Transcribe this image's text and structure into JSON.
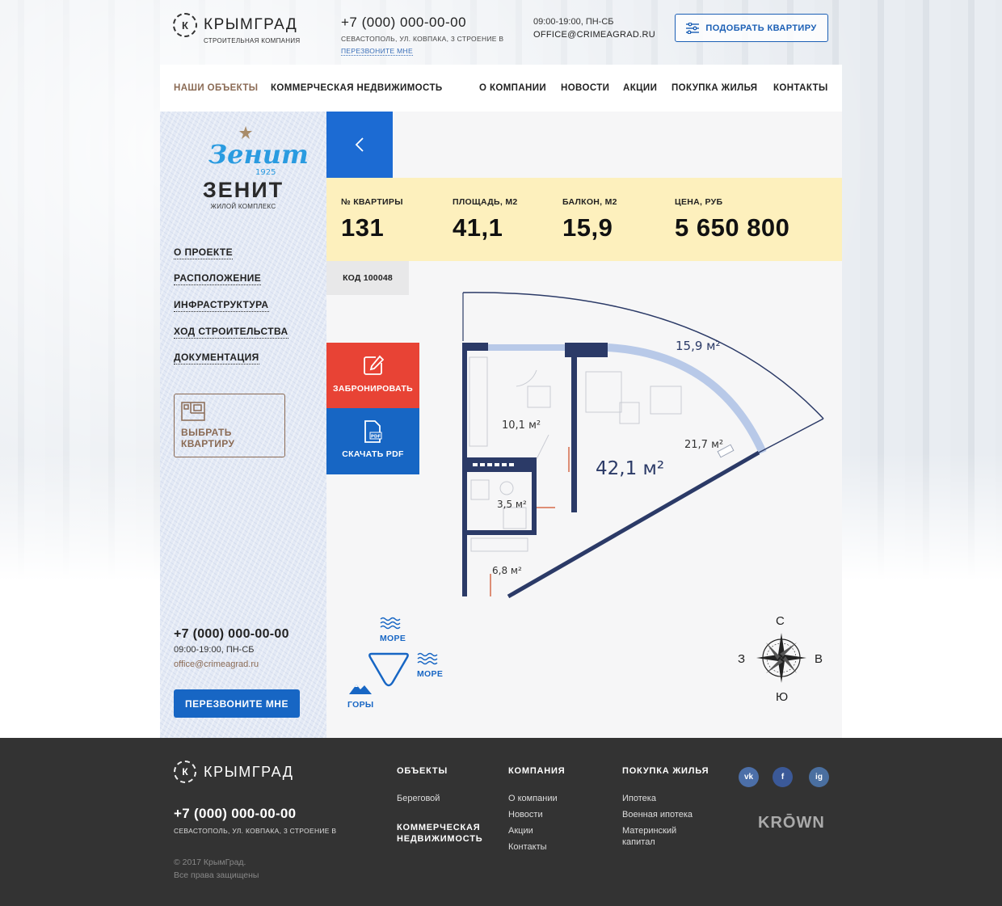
{
  "brand": {
    "name": "КРЫМГРАД",
    "subtitle": "СТРОИТЕЛЬНАЯ КОМПАНИЯ",
    "mark": "К"
  },
  "header": {
    "phone": "+7 (000) 000-00-00",
    "address": "СЕВАСТОПОЛЬ, УЛ. КОВПАКА, 3 СТРОЕНИЕ В",
    "callback_link": "ПЕРЕЗВОНИТЕ МНЕ",
    "hours": "09:00-19:00, ПН-СБ",
    "email": "OFFICE@CRIMEAGRAD.RU",
    "pick_button": "ПОДОБРАТЬ КВАРТИРУ"
  },
  "nav": {
    "items": [
      {
        "label": "НАШИ ОБЪЕКТЫ",
        "active": true
      },
      {
        "label": "КОММЕРЧЕСКАЯ НЕДВИЖИМОСТЬ"
      },
      {
        "label": "О КОМПАНИИ"
      },
      {
        "label": "НОВОСТИ"
      },
      {
        "label": "АКЦИИ"
      },
      {
        "label": "ПОКУПКА ЖИЛЬЯ"
      },
      {
        "label": "КОНТАКТЫ"
      }
    ]
  },
  "sidebar": {
    "project_logo_text": "Зенит",
    "project_logo_year": "1925",
    "project_name": "ЗЕНИТ",
    "project_sub": "ЖИЛОЙ КОМПЛЕКС",
    "links": [
      "О ПРОЕКТЕ",
      "РАСПОЛОЖЕНИЕ",
      "ИНФРАСТРУКТУРА",
      "ХОД СТРОИТЕЛЬСТВА",
      "ДОКУМЕНТАЦИЯ"
    ],
    "select_apartment": "ВЫБРАТЬ КВАРТИРУ",
    "phone": "+7 (000) 000-00-00",
    "hours": "09:00-19:00, ПН-СБ",
    "email": "office@crimeagrad.ru",
    "callback_button": "ПЕРЕЗВОНИТЕ МНЕ"
  },
  "apartment": {
    "stats": [
      {
        "label": "№ КВАРТИРЫ",
        "value": "131"
      },
      {
        "label": "ПЛОЩАДЬ, М2",
        "value": "41,1"
      },
      {
        "label": "БАЛКОН, М2",
        "value": "15,9"
      },
      {
        "label": "ЦЕНА, РУБ",
        "value": "5 650 800"
      }
    ],
    "code": "КОД 100048",
    "book_button": "ЗАБРОНИРОВАТЬ",
    "pdf_button": "СКАЧАТЬ PDF",
    "pdf_icon_text": "PDF",
    "areas": {
      "balcony": "15,9 м²",
      "kitchen": "10,1 м²",
      "living": "21,7 м²",
      "total": "42,1 м²",
      "bath": "3,5 м²",
      "hall": "6,8 м²"
    },
    "directions": {
      "sea_top": "МОРЕ",
      "sea_right": "МОРЕ",
      "mountains": "ГОРЫ"
    },
    "compass": {
      "n": "С",
      "s": "Ю",
      "w": "З",
      "e": "В"
    }
  },
  "footer": {
    "brand": "КРЫМГРАД",
    "phone": "+7 (000) 000-00-00",
    "address": "СЕВАСТОПОЛЬ, УЛ. КОВПАКА, 3 СТРОЕНИЕ В",
    "copyright": "© 2017 КрымГрад.",
    "rights": "Все права защищены",
    "col_objects": {
      "title": "ОБЪЕКТЫ",
      "links": [
        "Береговой"
      ],
      "title2": "КОММЕРЧЕСКАЯ НЕДВИЖИМОСТЬ"
    },
    "col_company": {
      "title": "КОМПАНИЯ",
      "links": [
        "О компании",
        "Новости",
        "Акции",
        "Контакты"
      ]
    },
    "col_buy": {
      "title": "ПОКУПКА ЖИЛЬЯ",
      "links": [
        "Ипотека",
        "Военная ипотека",
        "Материнский капитал"
      ]
    },
    "social": {
      "vk": "vk",
      "fb": "f",
      "ig": "ig"
    },
    "partner": "KRŌWN"
  },
  "colors": {
    "accent_blue": "#1766c4",
    "accent_red": "#e84335",
    "accent_brown": "#8a6a54",
    "stats_bg": "#fdf0bd",
    "plan_wall": "#2b3a67",
    "footer_bg": "#333333"
  }
}
